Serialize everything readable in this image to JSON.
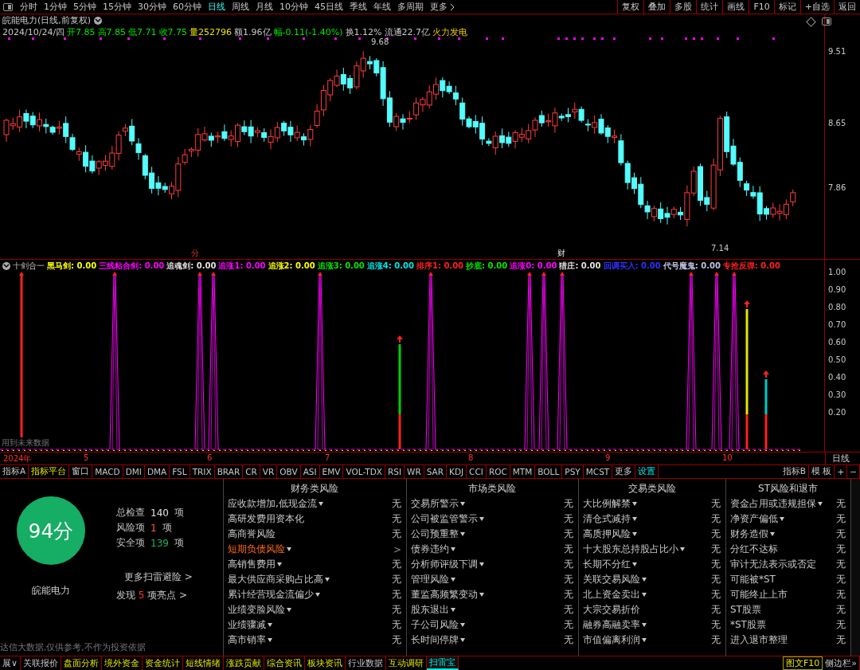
{
  "toolbar": {
    "periods": [
      {
        "label": "分时",
        "selected": false
      },
      {
        "label": "1分钟",
        "selected": false
      },
      {
        "label": "5分钟",
        "selected": false
      },
      {
        "label": "15分钟",
        "selected": false
      },
      {
        "label": "30分钟",
        "selected": false
      },
      {
        "label": "60分钟",
        "selected": false
      },
      {
        "label": "日线",
        "selected": true
      },
      {
        "label": "周线",
        "selected": false
      },
      {
        "label": "月线",
        "selected": false
      },
      {
        "label": "10分钟",
        "selected": false
      },
      {
        "label": "45日线",
        "selected": false
      },
      {
        "label": "季线",
        "selected": false
      },
      {
        "label": "年线",
        "selected": false
      },
      {
        "label": "多周期",
        "selected": false
      }
    ],
    "more": "更多",
    "buttons": [
      "复权",
      "叠加",
      "多股",
      "统计",
      "画线",
      "F10",
      "标记",
      "+自选",
      "返回"
    ]
  },
  "quote": {
    "title": "皖能电力(日线,前复权)",
    "date": "2024/10/24/四",
    "fields": [
      {
        "text": "开7.85",
        "kind": "price"
      },
      {
        "text": "高7.85",
        "kind": "price"
      },
      {
        "text": "低7.71",
        "kind": "price"
      },
      {
        "text": "收7.75",
        "kind": "price"
      },
      {
        "text": "量252796",
        "kind": "volume"
      },
      {
        "text": "额1.96亿",
        "kind": "plain"
      },
      {
        "text": "幅-0.11(-1.40%)",
        "kind": "price"
      },
      {
        "text": "换1.12%",
        "kind": "plain"
      },
      {
        "text": "流通22.7亿",
        "kind": "plain"
      },
      {
        "text": "火力发电",
        "kind": "industry"
      }
    ]
  },
  "price_chart": {
    "axis_labels": [
      "9.51",
      "8.65",
      "7.86"
    ],
    "high_label": "9.68",
    "low_label": "7.14",
    "event_marks": [
      {
        "text": "分",
        "kind": "rights"
      },
      {
        "text": "财",
        "kind": "finance"
      }
    ]
  },
  "indicator": {
    "name": "十剑合一",
    "lines": [
      {
        "text": "黑马剑: 0.00",
        "color": "#ffff00"
      },
      {
        "text": "三线粘合剑: 0.00",
        "color": "#ff00ff"
      },
      {
        "text": "追魂剑: 0.00",
        "color": "#e0e0e0"
      },
      {
        "text": "追涨1: 0.00",
        "color": "#ff00ff"
      },
      {
        "text": "追涨2: 0.00",
        "color": "#ffff00"
      },
      {
        "text": "追涨3: 0.00",
        "color": "#00e600"
      },
      {
        "text": "追涨4: 0.00",
        "color": "#00e6e6"
      },
      {
        "text": "排序1: 0.00",
        "color": "#ff2020"
      },
      {
        "text": "抄底: 0.00",
        "color": "#00e600"
      },
      {
        "text": "追涨0: 0.00",
        "color": "#ff00ff"
      },
      {
        "text": "猎庄: 0.00",
        "color": "#e0e0e0"
      },
      {
        "text": "回调买入: 0.00",
        "color": "#3030ff"
      },
      {
        "text": "代号魔鬼: 0.00",
        "color": "#c0c0e0"
      },
      {
        "text": "专抢反弹: 0.00",
        "color": "#ff2020"
      }
    ],
    "axis_labels": [
      "1.00",
      "0.90",
      "0.80",
      "0.70",
      "0.60",
      "0.50",
      "0.40",
      "0.30",
      "0.20"
    ],
    "note": "用到未来数据"
  },
  "date_axis": {
    "labels": [
      "2024年",
      "5",
      "6",
      "7",
      "8",
      "9",
      "10"
    ],
    "unit": "日线"
  },
  "indicator_tabs": [
    {
      "label": "指标A",
      "kind": "plain"
    },
    {
      "label": "指标平台",
      "kind": "platform"
    },
    {
      "label": "窗口",
      "kind": "plain"
    },
    {
      "label": "MACD",
      "kind": "plain"
    },
    {
      "label": "DMI",
      "kind": "plain"
    },
    {
      "label": "DMA",
      "kind": "plain"
    },
    {
      "label": "FSL",
      "kind": "plain"
    },
    {
      "label": "TRIX",
      "kind": "plain"
    },
    {
      "label": "BRAR",
      "kind": "plain"
    },
    {
      "label": "CR",
      "kind": "plain"
    },
    {
      "label": "VR",
      "kind": "plain"
    },
    {
      "label": "OBV",
      "kind": "plain"
    },
    {
      "label": "ASI",
      "kind": "plain"
    },
    {
      "label": "EMV",
      "kind": "plain"
    },
    {
      "label": "VOL-TDX",
      "kind": "plain"
    },
    {
      "label": "RSI",
      "kind": "plain"
    },
    {
      "label": "WR",
      "kind": "plain"
    },
    {
      "label": "SAR",
      "kind": "plain"
    },
    {
      "label": "KDJ",
      "kind": "plain"
    },
    {
      "label": "CCI",
      "kind": "plain"
    },
    {
      "label": "ROC",
      "kind": "plain"
    },
    {
      "label": "MTM",
      "kind": "plain"
    },
    {
      "label": "BOLL",
      "kind": "plain"
    },
    {
      "label": "PSY",
      "kind": "plain"
    },
    {
      "label": "MCST",
      "kind": "plain"
    },
    {
      "label": "更多",
      "kind": "plain"
    },
    {
      "label": "设置",
      "kind": "settings"
    }
  ],
  "indicator_tabs_right": [
    "指标B",
    "模 板",
    "+",
    "−"
  ],
  "scan": {
    "score": "94分",
    "stock": "皖能电力",
    "stats": [
      {
        "label": "总检查",
        "value": "140",
        "unit": "项",
        "kind": "total"
      },
      {
        "label": "风险项",
        "value": "1",
        "unit": "项",
        "kind": "risk"
      },
      {
        "label": "安全项",
        "value": "139",
        "unit": "项",
        "kind": "safe"
      }
    ],
    "more_link": "更多扫雷避险 >",
    "highlights": {
      "before": "发现",
      "count": "5",
      "after": "项亮点 >"
    },
    "disclaimer": "达信大数据,仅供参考,不作为投资依据",
    "columns": [
      {
        "title": "财务类风险",
        "items": [
          {
            "label": "应收款增加,低现金流",
            "dropdown": true,
            "alert": false,
            "result": "无"
          },
          {
            "label": "高研发费用资本化",
            "dropdown": false,
            "alert": false,
            "result": "无"
          },
          {
            "label": "高商誉风险",
            "dropdown": false,
            "alert": false,
            "result": "无"
          },
          {
            "label": "短期负债风险",
            "dropdown": true,
            "alert": true,
            "result": ">"
          },
          {
            "label": "高销售费用",
            "dropdown": true,
            "alert": false,
            "result": "无"
          },
          {
            "label": "最大供应商采购占比高",
            "dropdown": true,
            "alert": false,
            "result": "无"
          },
          {
            "label": "累计经营现金流偏少",
            "dropdown": true,
            "alert": false,
            "result": "无"
          },
          {
            "label": "业绩变脸风险",
            "dropdown": true,
            "alert": false,
            "result": "无"
          },
          {
            "label": "业绩骤减",
            "dropdown": true,
            "alert": false,
            "result": "无"
          },
          {
            "label": "高市销率",
            "dropdown": true,
            "alert": false,
            "result": "无"
          }
        ]
      },
      {
        "title": "市场类风险",
        "items": [
          {
            "label": "交易所警示",
            "dropdown": true,
            "alert": false,
            "result": "无"
          },
          {
            "label": "公司被监管警示",
            "dropdown": true,
            "alert": false,
            "result": "无"
          },
          {
            "label": "公司预重整",
            "dropdown": true,
            "alert": false,
            "result": "无"
          },
          {
            "label": "债券违约",
            "dropdown": true,
            "alert": false,
            "result": "无"
          },
          {
            "label": "分析师评级下调",
            "dropdown": true,
            "alert": false,
            "result": "无"
          },
          {
            "label": "管理风险",
            "dropdown": true,
            "alert": false,
            "result": "无"
          },
          {
            "label": "董监高频繁变动",
            "dropdown": true,
            "alert": false,
            "result": "无"
          },
          {
            "label": "股东退出",
            "dropdown": true,
            "alert": false,
            "result": "无"
          },
          {
            "label": "子公司风险",
            "dropdown": true,
            "alert": false,
            "result": "无"
          },
          {
            "label": "长时间停牌",
            "dropdown": true,
            "alert": false,
            "result": "无"
          }
        ]
      },
      {
        "title": "交易类风险",
        "items": [
          {
            "label": "大比例解禁",
            "dropdown": true,
            "alert": false,
            "result": "无"
          },
          {
            "label": "清仓式减持",
            "dropdown": true,
            "alert": false,
            "result": "无"
          },
          {
            "label": "高质押风险",
            "dropdown": true,
            "alert": false,
            "result": "无"
          },
          {
            "label": "十大股东总持股占比小",
            "dropdown": true,
            "alert": false,
            "result": "无"
          },
          {
            "label": "长期不分红",
            "dropdown": true,
            "alert": false,
            "result": "无"
          },
          {
            "label": "关联交易风险",
            "dropdown": true,
            "alert": false,
            "result": "无"
          },
          {
            "label": "北上资金卖出",
            "dropdown": true,
            "alert": false,
            "result": "无"
          },
          {
            "label": "大宗交易折价",
            "dropdown": false,
            "alert": false,
            "result": "无"
          },
          {
            "label": "融券高融卖率",
            "dropdown": true,
            "alert": false,
            "result": "无"
          },
          {
            "label": "市值偏离利润",
            "dropdown": true,
            "alert": false,
            "result": "无"
          }
        ]
      },
      {
        "title": "ST风险和退市",
        "items": [
          {
            "label": "资金占用或违规担保",
            "dropdown": true,
            "alert": false,
            "result": "无"
          },
          {
            "label": "净资产偏低",
            "dropdown": true,
            "alert": false,
            "result": "无"
          },
          {
            "label": "财务造假",
            "dropdown": true,
            "alert": false,
            "result": "无"
          },
          {
            "label": "分红不达标",
            "dropdown": false,
            "alert": false,
            "result": "无"
          },
          {
            "label": "审计无法表示或否定",
            "dropdown": false,
            "alert": false,
            "result": "无"
          },
          {
            "label": "可能被*ST",
            "dropdown": false,
            "alert": false,
            "result": "无"
          },
          {
            "label": "可能终止上市",
            "dropdown": false,
            "alert": false,
            "result": "无"
          },
          {
            "label": "ST股票",
            "dropdown": false,
            "alert": false,
            "result": "无"
          },
          {
            "label": "*ST股票",
            "dropdown": false,
            "alert": false,
            "result": "无"
          },
          {
            "label": "进入退市整理",
            "dropdown": false,
            "alert": false,
            "result": "无"
          }
        ]
      }
    ]
  },
  "bottom_tabs": [
    {
      "label": "展∨",
      "kind": "plain",
      "selected": false
    },
    {
      "label": "关联报价",
      "kind": "plain",
      "selected": false
    },
    {
      "label": "盘面分析",
      "kind": "info",
      "selected": false
    },
    {
      "label": "境外资金",
      "kind": "info",
      "selected": false
    },
    {
      "label": "资金统计",
      "kind": "info",
      "selected": false
    },
    {
      "label": "短线情绪",
      "kind": "info",
      "selected": false
    },
    {
      "label": "涨跌贡献",
      "kind": "info",
      "selected": false
    },
    {
      "label": "综合资讯",
      "kind": "info",
      "selected": false
    },
    {
      "label": "板块资讯",
      "kind": "info",
      "selected": false
    },
    {
      "label": "行业数据",
      "kind": "plain",
      "selected": false
    },
    {
      "label": "互动调研",
      "kind": "info",
      "selected": false
    },
    {
      "label": "扫雷宝",
      "kind": "settings",
      "selected": true
    }
  ],
  "bottom_right": [
    "图文F10",
    "侧边栏»"
  ]
}
